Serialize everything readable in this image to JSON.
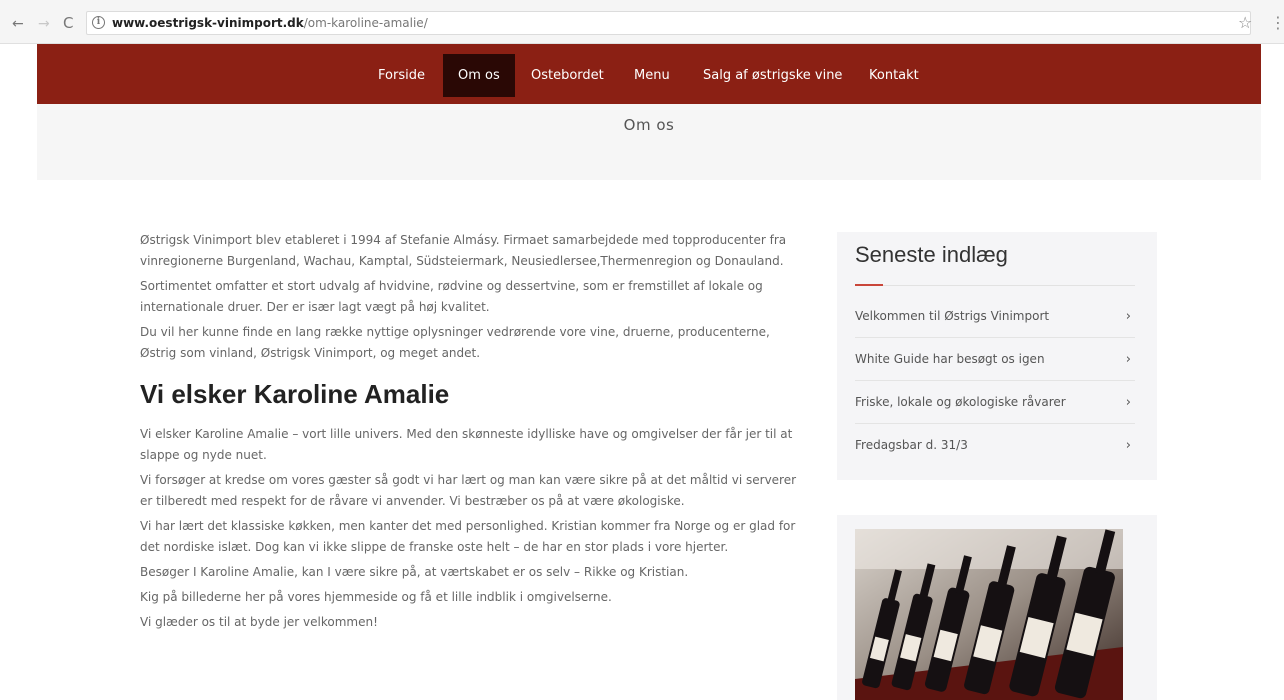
{
  "browser": {
    "url_host": "www.oestrigsk-vinimport.dk",
    "url_path": "/om-karoline-amalie/",
    "info_glyph": "i",
    "back_icon": "←",
    "forward_icon": "→",
    "reload_icon": "C",
    "star_icon": "☆",
    "menu_icon": "⋮"
  },
  "nav": {
    "items": [
      {
        "label": "Forside"
      },
      {
        "label": "Om os"
      },
      {
        "label": "Ostebordet"
      },
      {
        "label": "Menu"
      },
      {
        "label": "Salg af østrigske vine"
      },
      {
        "label": "Kontakt"
      }
    ],
    "active_index": 1
  },
  "banner": {
    "title": "Om os"
  },
  "content": {
    "intro": [
      "Østrigsk Vinimport blev etableret i 1994 af Stefanie Almásy. Firmaet samarbejdede med topproducenter fra vinregionerne Burgenland, Wachau, Kamptal, Südsteiermark, Neusiedlersee,Thermenregion og Donauland.",
      "Sortimentet omfatter et stort udvalg af hvidvine, rødvine og dessertvine, som er fremstillet af lokale og internationale druer. Der er især lagt vægt på høj kvalitet.",
      "Du vil her kunne finde en lang række nyttige oplysninger vedrørende vore vine, druerne, producenterne, Østrig som vinland, Østrigsk Vinimport, og meget andet."
    ],
    "heading": "Vi elsker Karoline Amalie",
    "body": [
      "Vi elsker Karoline Amalie – vort lille univers. Med den skønneste idylliske have og omgivelser der får jer til at slappe og nyde nuet.",
      "Vi forsøger at kredse om vores gæster så godt vi har lært og man kan være sikre på at det måltid vi serverer er tilberedt med respekt for de råvare vi anvender. Vi bestræber os på at være økologiske.",
      "Vi har lært det klassiske køkken, men kanter det med personlighed. Kristian kommer fra Norge og er glad for det nordiske islæt. Dog kan vi ikke slippe de franske oste helt – de har en stor plads i vore hjerter.",
      "Besøger I Karoline Amalie, kan I være sikre på, at værtskabet er os selv – Rikke og Kristian.",
      "Kig på billederne her på vores hjemmeside og få et lille indblik i omgivelserne.",
      "Vi glæder os til at byde jer velkommen!"
    ]
  },
  "sidebar": {
    "title": "Seneste indlæg",
    "posts": [
      {
        "label": "Velkommen til Østrigs Vinimport"
      },
      {
        "label": "White Guide har besøgt os igen"
      },
      {
        "label": "Friske, lokale og økologiske råvarer"
      },
      {
        "label": "Fredagsbar d. 31/3"
      }
    ],
    "chevron": "›"
  },
  "colors": {
    "nav_bg": "#8b2014",
    "nav_active_bg": "#2a0805",
    "accent": "#c9463a"
  }
}
